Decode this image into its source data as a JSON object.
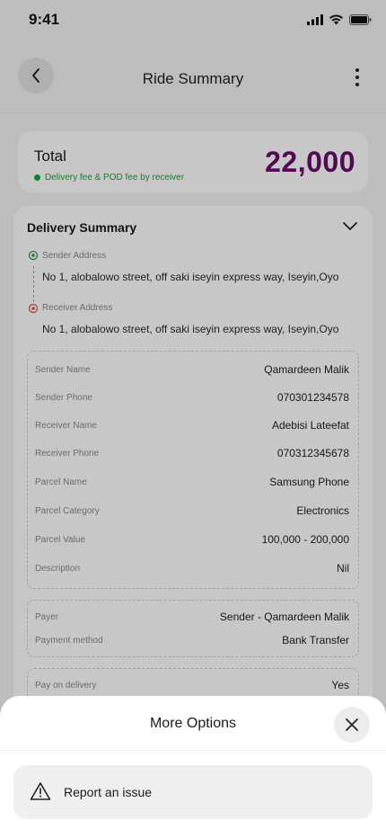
{
  "status_bar": {
    "time": "9:41"
  },
  "header": {
    "title": "Ride Summary"
  },
  "total": {
    "label": "Total",
    "note": "Delivery fee & POD fee by receiver",
    "amount": "22,000"
  },
  "delivery_summary": {
    "title": "Delivery Summary",
    "sender_address_label": "Sender Address",
    "sender_address": "No 1, alobalowo street, off saki iseyin express way, Iseyin,Oyo",
    "receiver_address_label": "Receiver Address",
    "receiver_address": "No 1, alobalowo street, off saki iseyin express way, Iseyin,Oyo",
    "details": [
      {
        "key": "Sender Name",
        "value": "Qamardeen Malik"
      },
      {
        "key": "Sender Phone",
        "value": "070301234578"
      },
      {
        "key": "Receiver Name",
        "value": "Adebisi Lateefat"
      },
      {
        "key": "Receiver Phone",
        "value": "070312345678"
      },
      {
        "key": "Parcel Name",
        "value": "Samsung Phone"
      },
      {
        "key": "Parcel Category",
        "value": "Electronics"
      },
      {
        "key": "Parcel Value",
        "value": "100,000 - 200,000"
      },
      {
        "key": "Description",
        "value": "Nil"
      }
    ],
    "payment": [
      {
        "key": "Payer",
        "value": "Sender - Qamardeen Malik"
      },
      {
        "key": "Payment method",
        "value": "Bank Transfer"
      }
    ],
    "pod": [
      {
        "key": "Pay on delivery",
        "value": "Yes"
      }
    ]
  },
  "sheet": {
    "title": "More Options",
    "report_label": "Report an issue"
  },
  "colors": {
    "accent": "#6b0b6b",
    "success": "#1f9e3e",
    "sender_pin": "#2f9e44",
    "receiver_pin": "#d9534f"
  },
  "icons": [
    "back-arrow-icon",
    "more-vertical-icon",
    "chevron-down-icon",
    "sender-pin-icon",
    "receiver-pin-icon",
    "close-icon",
    "warning-icon"
  ]
}
